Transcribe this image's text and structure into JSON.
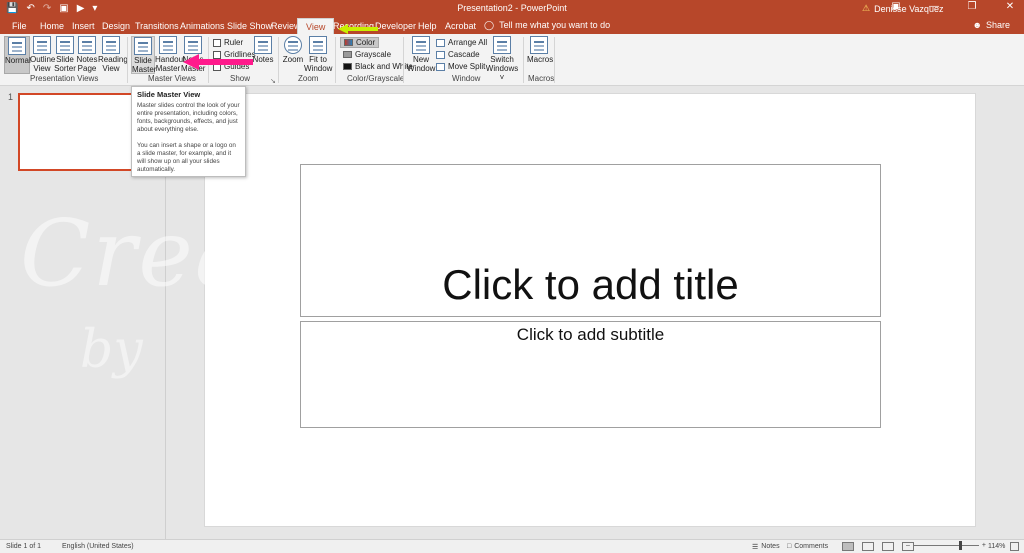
{
  "titlebar": {
    "title": "Presentation2  -  PowerPoint",
    "user": "Denisse Vazquez",
    "warning_icon": "warning-icon",
    "qat": [
      "save-icon",
      "undo-icon",
      "redo-icon",
      "present-icon",
      "start-from-beginning-icon",
      "customize-qat-icon"
    ],
    "window_controls": [
      "ribbon-display-options-icon",
      "minimize-icon",
      "restore-icon",
      "close-icon"
    ]
  },
  "tabs": {
    "file": "File",
    "home": "Home",
    "insert": "Insert",
    "design": "Design",
    "transitions": "Transitions",
    "animations": "Animations",
    "slideshow": "Slide Show",
    "review": "Review",
    "view": "View",
    "recording": "Recording",
    "developer": "Developer",
    "help": "Help",
    "acrobat": "Acrobat",
    "tellme": "Tell me what you want to do",
    "share": "Share",
    "active": "View"
  },
  "ribbon": {
    "presentation_views": {
      "label": "Presentation Views",
      "normal": "Normal",
      "outline1": "Outline",
      "outline2": "View",
      "sorter1": "Slide",
      "sorter2": "Sorter",
      "notes1": "Notes",
      "notes2": "Page",
      "reading1": "Reading",
      "reading2": "View"
    },
    "master_views": {
      "label": "Master Views",
      "slide1": "Slide",
      "slide2": "Master",
      "handout1": "Handout",
      "handout2": "Master",
      "notes1": "Notes",
      "notes2": "Master"
    },
    "show": {
      "label": "Show",
      "ruler": "Ruler",
      "gridlines": "Gridlines",
      "guides": "Guides",
      "notes": "Notes"
    },
    "zoom": {
      "label": "Zoom",
      "zoom": "Zoom",
      "fit1": "Fit to",
      "fit2": "Window"
    },
    "color": {
      "label": "Color/Grayscale",
      "color": "Color",
      "grayscale": "Grayscale",
      "bw": "Black and White"
    },
    "window": {
      "label": "Window",
      "new1": "New",
      "new2": "Window",
      "arrange": "Arrange All",
      "cascade": "Cascade",
      "split": "Move Split",
      "switch1": "Switch",
      "switch2": "Windows ˅"
    },
    "macros": {
      "label": "Macros",
      "macros": "Macros"
    }
  },
  "tooltip": {
    "title": "Slide Master View",
    "p1": "Master slides control the look of your entire presentation, including colors, fonts, backgrounds, effects, and just about everything else.",
    "p2": "You can insert a shape or a logo on a slide master, for example, and it will show up on all your slides automatically."
  },
  "thumbnails": {
    "number": "1"
  },
  "slide": {
    "title_placeholder": "Click to add title",
    "subtitle_placeholder": "Click to add subtitle"
  },
  "watermark": {
    "line1": "Crea",
    "line2": "by",
    "line3": "e"
  },
  "statusbar": {
    "slide": "Slide 1 of 1",
    "language": "English (United States)",
    "notes": "Notes",
    "comments": "Comments",
    "zoom": "114%"
  },
  "colors": {
    "brand": "#b7472a",
    "arrow_pink": "#ff1a8c",
    "arrow_green": "#c8f000",
    "thumb_border": "#d24726"
  }
}
